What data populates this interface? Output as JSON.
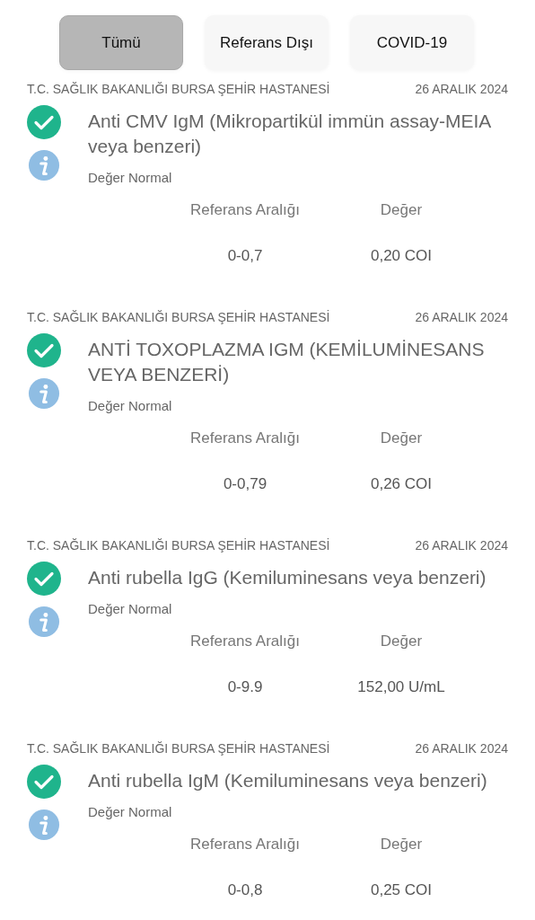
{
  "tabs": [
    {
      "label": "Tümü",
      "selected": true
    },
    {
      "label": "Referans Dışı",
      "selected": false
    },
    {
      "label": "COVID-19",
      "selected": false
    }
  ],
  "results": [
    {
      "institution": "T.C. SAĞLIK BAKANLIĞI BURSA ŞEHİR HASTANESİ",
      "date": "26 ARALIK 2024",
      "test": "Anti CMV IgM (Mikropartikül immün assay-MEIA veya benzeri)",
      "status": "Değer Normal",
      "range_label": "Referans Aralığı",
      "value_label": "Değer",
      "range": "0-0,7",
      "value": "0,20 COI"
    },
    {
      "institution": "T.C. SAĞLIK BAKANLIĞI BURSA ŞEHİR HASTANESİ",
      "date": "26 ARALIK 2024",
      "test": "ANTİ TOXOPLAZMA IGM (KEMİLUMİNESANS VEYA BENZERİ)",
      "status": "Değer Normal",
      "range_label": "Referans Aralığı",
      "value_label": "Değer",
      "range": "0-0,79",
      "value": "0,26 COI"
    },
    {
      "institution": "T.C. SAĞLIK BAKANLIĞI BURSA ŞEHİR HASTANESİ",
      "date": "26 ARALIK 2024",
      "test": "Anti rubella IgG (Kemiluminesans veya benzeri)",
      "status": "Değer Normal",
      "range_label": "Referans Aralığı",
      "value_label": "Değer",
      "range": "0-9.9",
      "value": "152,00 U/mL"
    },
    {
      "institution": "T.C. SAĞLIK BAKANLIĞI BURSA ŞEHİR HASTANESİ",
      "date": "26 ARALIK 2024",
      "test": "Anti rubella IgM (Kemiluminesans veya benzeri)",
      "status": "Değer Normal",
      "range_label": "Referans Aralığı",
      "value_label": "Değer",
      "range": "0-0,8",
      "value": "0,25 COI"
    }
  ]
}
